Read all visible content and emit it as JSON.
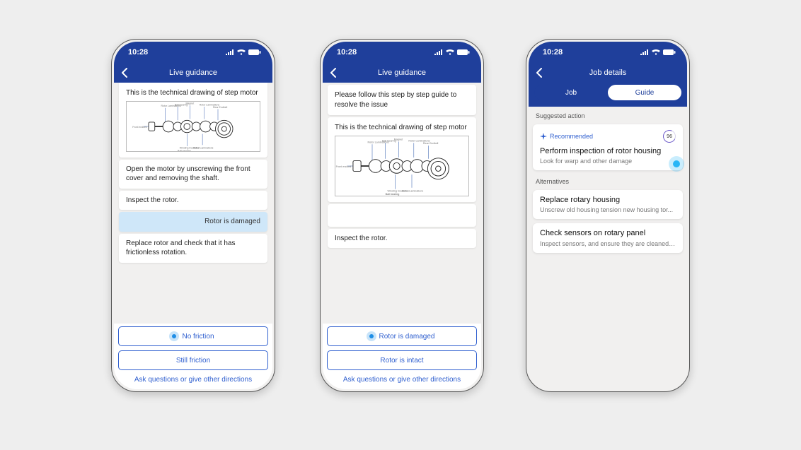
{
  "phones": [
    {
      "status_time": "10:28",
      "header_title": "Live guidance",
      "drawing_caption": "This is the technical drawing of step motor",
      "steps": {
        "open_motor": "Open the motor by unscrewing the front cover and removing the shaft.",
        "inspect": "Inspect the rotor.",
        "user_reply": "Rotor is damaged",
        "replace": "Replace rotor and check that it has frictionless rotation."
      },
      "options": {
        "a": "No friction",
        "b": "Still friction"
      },
      "ask_link": "Ask questions or give other directions"
    },
    {
      "status_time": "10:28",
      "header_title": "Live guidance",
      "intro": "Please follow this step by step guide to resolve the issue",
      "drawing_caption": "This is the technical drawing of step motor",
      "inspect": "Inspect the rotor.",
      "options": {
        "a": "Rotor is damaged",
        "b": "Rotor is intact"
      },
      "ask_link": "Ask questions or give other directions"
    },
    {
      "status_time": "10:28",
      "header_title": "Job details",
      "tabs": {
        "job": "Job",
        "guide": "Guide"
      },
      "suggested_label": "Suggested action",
      "recommended_label": "Recommended",
      "recommended_score": "96",
      "rec_title": "Perform inspection of rotor housing",
      "rec_sub": "Look for warp and other damage",
      "alt_label": "Alternatives",
      "alt1_title": "Replace rotary housing",
      "alt1_sub": "Unscrew old housing tension new housing tor...",
      "alt2_title": "Check sensors on rotary panel",
      "alt2_sub": "Inspect sensors, and ensure they are cleaned o..."
    }
  ]
}
